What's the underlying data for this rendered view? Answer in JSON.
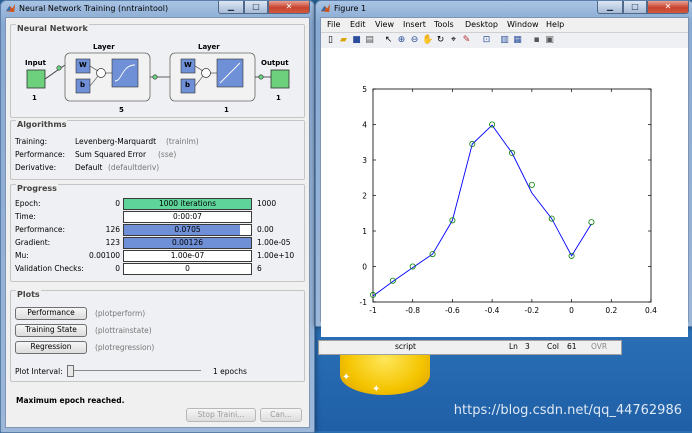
{
  "nntraintool": {
    "title": "Neural Network Training (nntraintool)",
    "network": {
      "heading": "Neural Network",
      "input_label": "Input",
      "input_size": "1",
      "layer_label": "Layer",
      "layer1_size": "5",
      "layer2_size": "1",
      "output_label": "Output",
      "output_size": "1",
      "w_label": "W",
      "b_label": "b"
    },
    "algorithms": {
      "heading": "Algorithms",
      "rows": [
        {
          "label": "Training:",
          "value": "Levenberg-Marquardt",
          "fn": "(trainlm)"
        },
        {
          "label": "Performance:",
          "value": "Sum Squared Error",
          "fn": "(sse)"
        },
        {
          "label": "Derivative:",
          "value": "Default",
          "fn": "(defaultderiv)"
        }
      ]
    },
    "progress": {
      "heading": "Progress",
      "rows": [
        {
          "label": "Epoch:",
          "start": "0",
          "bar": "1000 iterations",
          "end": "1000",
          "fill": 1.0,
          "color": "#5fd49a"
        },
        {
          "label": "Time:",
          "start": "",
          "bar": "0:00:07",
          "end": "",
          "fill": 0.0,
          "color": "#ffffff"
        },
        {
          "label": "Performance:",
          "start": "126",
          "bar": "0.0705",
          "end": "0.00",
          "fill": 0.91,
          "color": "#6f8fd6"
        },
        {
          "label": "Gradient:",
          "start": "123",
          "bar": "0.00126",
          "end": "1.00e-05",
          "fill": 1.0,
          "color": "#6f8fd6"
        },
        {
          "label": "Mu:",
          "start": "0.00100",
          "bar": "1.00e-07",
          "end": "1.00e+10",
          "fill": 0.0,
          "color": "#ffffff"
        },
        {
          "label": "Validation Checks:",
          "start": "0",
          "bar": "0",
          "end": "6",
          "fill": 0.0,
          "color": "#ffffff"
        }
      ]
    },
    "plots": {
      "heading": "Plots",
      "buttons": [
        {
          "label": "Performance",
          "fn": "(plotperform)"
        },
        {
          "label": "Training State",
          "fn": "(plottrainstate)"
        },
        {
          "label": "Regression",
          "fn": "(plotregression)"
        }
      ],
      "interval_label": "Plot Interval:",
      "interval_value": "1 epochs"
    },
    "status_message": "Maximum epoch reached.",
    "stop_button": "Stop Traini...",
    "cancel_button": "Can..."
  },
  "figure": {
    "title": "Figure 1",
    "menu": [
      "File",
      "Edit",
      "View",
      "Insert",
      "Tools",
      "Desktop",
      "Window",
      "Help"
    ],
    "toolbar_icons": [
      "new-file-icon",
      "open-folder-icon",
      "save-icon",
      "print-icon",
      "pointer-icon",
      "zoom-in-icon",
      "zoom-out-icon",
      "pan-icon",
      "rotate-icon",
      "data-cursor-icon",
      "brush-icon",
      "link-plot-icon",
      "colorbar-icon",
      "legend-icon",
      "hide-plot-tools-icon",
      "show-plot-tools-icon"
    ]
  },
  "chart_data": {
    "type": "line",
    "xlim": [
      -1,
      0.4
    ],
    "ylim": [
      -1,
      5
    ],
    "xticks": [
      "-1",
      "-0.8",
      "-0.6",
      "-0.4",
      "-0.2",
      "0",
      "0.2",
      "0.4"
    ],
    "yticks": [
      "-1",
      "0",
      "1",
      "2",
      "3",
      "4",
      "5"
    ],
    "xtick_values": [
      -1,
      -0.8,
      -0.6,
      -0.4,
      -0.2,
      0,
      0.2,
      0.4
    ],
    "ytick_values": [
      -1,
      0,
      1,
      2,
      3,
      4,
      5
    ],
    "series": [
      {
        "style": "line",
        "color": "#0000ff",
        "x": [
          -1,
          -0.9,
          -0.8,
          -0.7,
          -0.6,
          -0.5,
          -0.4,
          -0.3,
          -0.2,
          -0.1,
          0,
          0.1
        ],
        "y": [
          -0.83,
          -0.42,
          -0.03,
          0.35,
          1.3,
          3.45,
          3.98,
          3.2,
          2.07,
          1.35,
          0.3,
          1.2
        ]
      },
      {
        "style": "markers",
        "color": "#008000",
        "x": [
          -1,
          -0.9,
          -0.8,
          -0.7,
          -0.6,
          -0.5,
          -0.4,
          -0.3,
          -0.2,
          -0.1,
          0,
          0.1
        ],
        "y": [
          -0.8,
          -0.4,
          0,
          0.35,
          1.3,
          3.45,
          4.0,
          3.2,
          2.3,
          1.35,
          0.3,
          1.25
        ]
      }
    ],
    "grid": false
  },
  "editor_status": {
    "mode": "script",
    "ln_label": "Ln",
    "ln": "3",
    "col_label": "Col",
    "col": "61",
    "ovr": "OVR"
  },
  "watermark": "https://blog.csdn.net/qq_44762986"
}
